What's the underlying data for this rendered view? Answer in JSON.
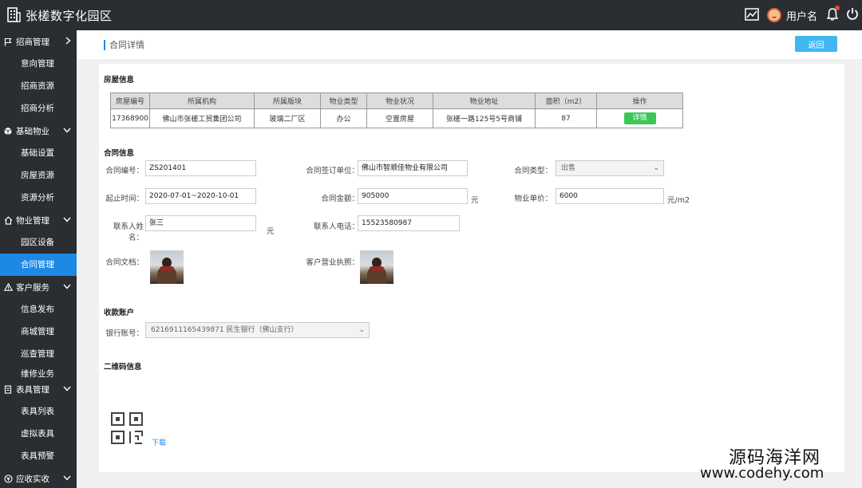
{
  "app": {
    "title": "张槎数字化园区",
    "username": "用户名"
  },
  "sidebar": {
    "groups": [
      {
        "label": "招商管理",
        "items": [
          "意向管理",
          "招商资源",
          "招商分析"
        ]
      },
      {
        "label": "基础物业",
        "items": [
          "基础设置",
          "房屋资源",
          "资源分析"
        ]
      },
      {
        "label": "物业管理",
        "items": [
          "园区设备",
          "合同管理"
        ]
      },
      {
        "label": "客户服务",
        "items": [
          "信息发布",
          "商城管理",
          "巡查管理",
          "维修业务"
        ]
      },
      {
        "label": "表具管理",
        "items": [
          "表具列表",
          "虚拟表具",
          "表具预警"
        ]
      },
      {
        "label": "应收实收",
        "items": []
      }
    ],
    "active_item": "合同管理"
  },
  "page": {
    "title": "合同详情",
    "back_label": "返回"
  },
  "house": {
    "section_title": "房屋信息",
    "columns": [
      "房屋编号",
      "所属机构",
      "所属版块",
      "物业类型",
      "物业状况",
      "物业地址",
      "面积（m2）",
      "操作"
    ],
    "row": [
      "17368900",
      "佛山市张槎工贸集团公司",
      "玻璃二厂区",
      "办公",
      "空置房屋",
      "张槎一路125号5号商铺",
      "87"
    ],
    "action_label": "详情"
  },
  "contract": {
    "section_title": "合同信息",
    "number_label": "合同编号：",
    "number": "ZS201401",
    "unit_label": "合同签订单位：",
    "unit": "佛山市智顺佳物业有限公司",
    "type_label": "合同类型：",
    "type": "出售",
    "period_label": "起止时间：",
    "period": "2020-07-01~2020-10-01",
    "amount_label": "合同金额：",
    "amount": "905000",
    "amount_unit": "元",
    "price_label": "物业单价：",
    "price": "6000",
    "price_unit": "元/m2",
    "contact_label": "联系人姓名：",
    "contact": "张三",
    "contact_unit": "元",
    "phone_label": "联系人电话：",
    "phone": "15523580987",
    "doc_label": "合同文档：",
    "license_label": "客户营业执照："
  },
  "account": {
    "section_title": "收款账户",
    "bank_label": "银行账号：",
    "bank": "6216911165439871  民生银行（佛山支行）"
  },
  "qrcode": {
    "section_title": "二维码信息",
    "download_label": "下载"
  },
  "watermark": {
    "line1": "源码海洋网",
    "line2": "www.codehy.com"
  },
  "colors": {
    "accent": "#1e88e5",
    "topbar": "#2a2d31",
    "back_button": "#42b6f0",
    "detail_button": "#3cc75b"
  }
}
